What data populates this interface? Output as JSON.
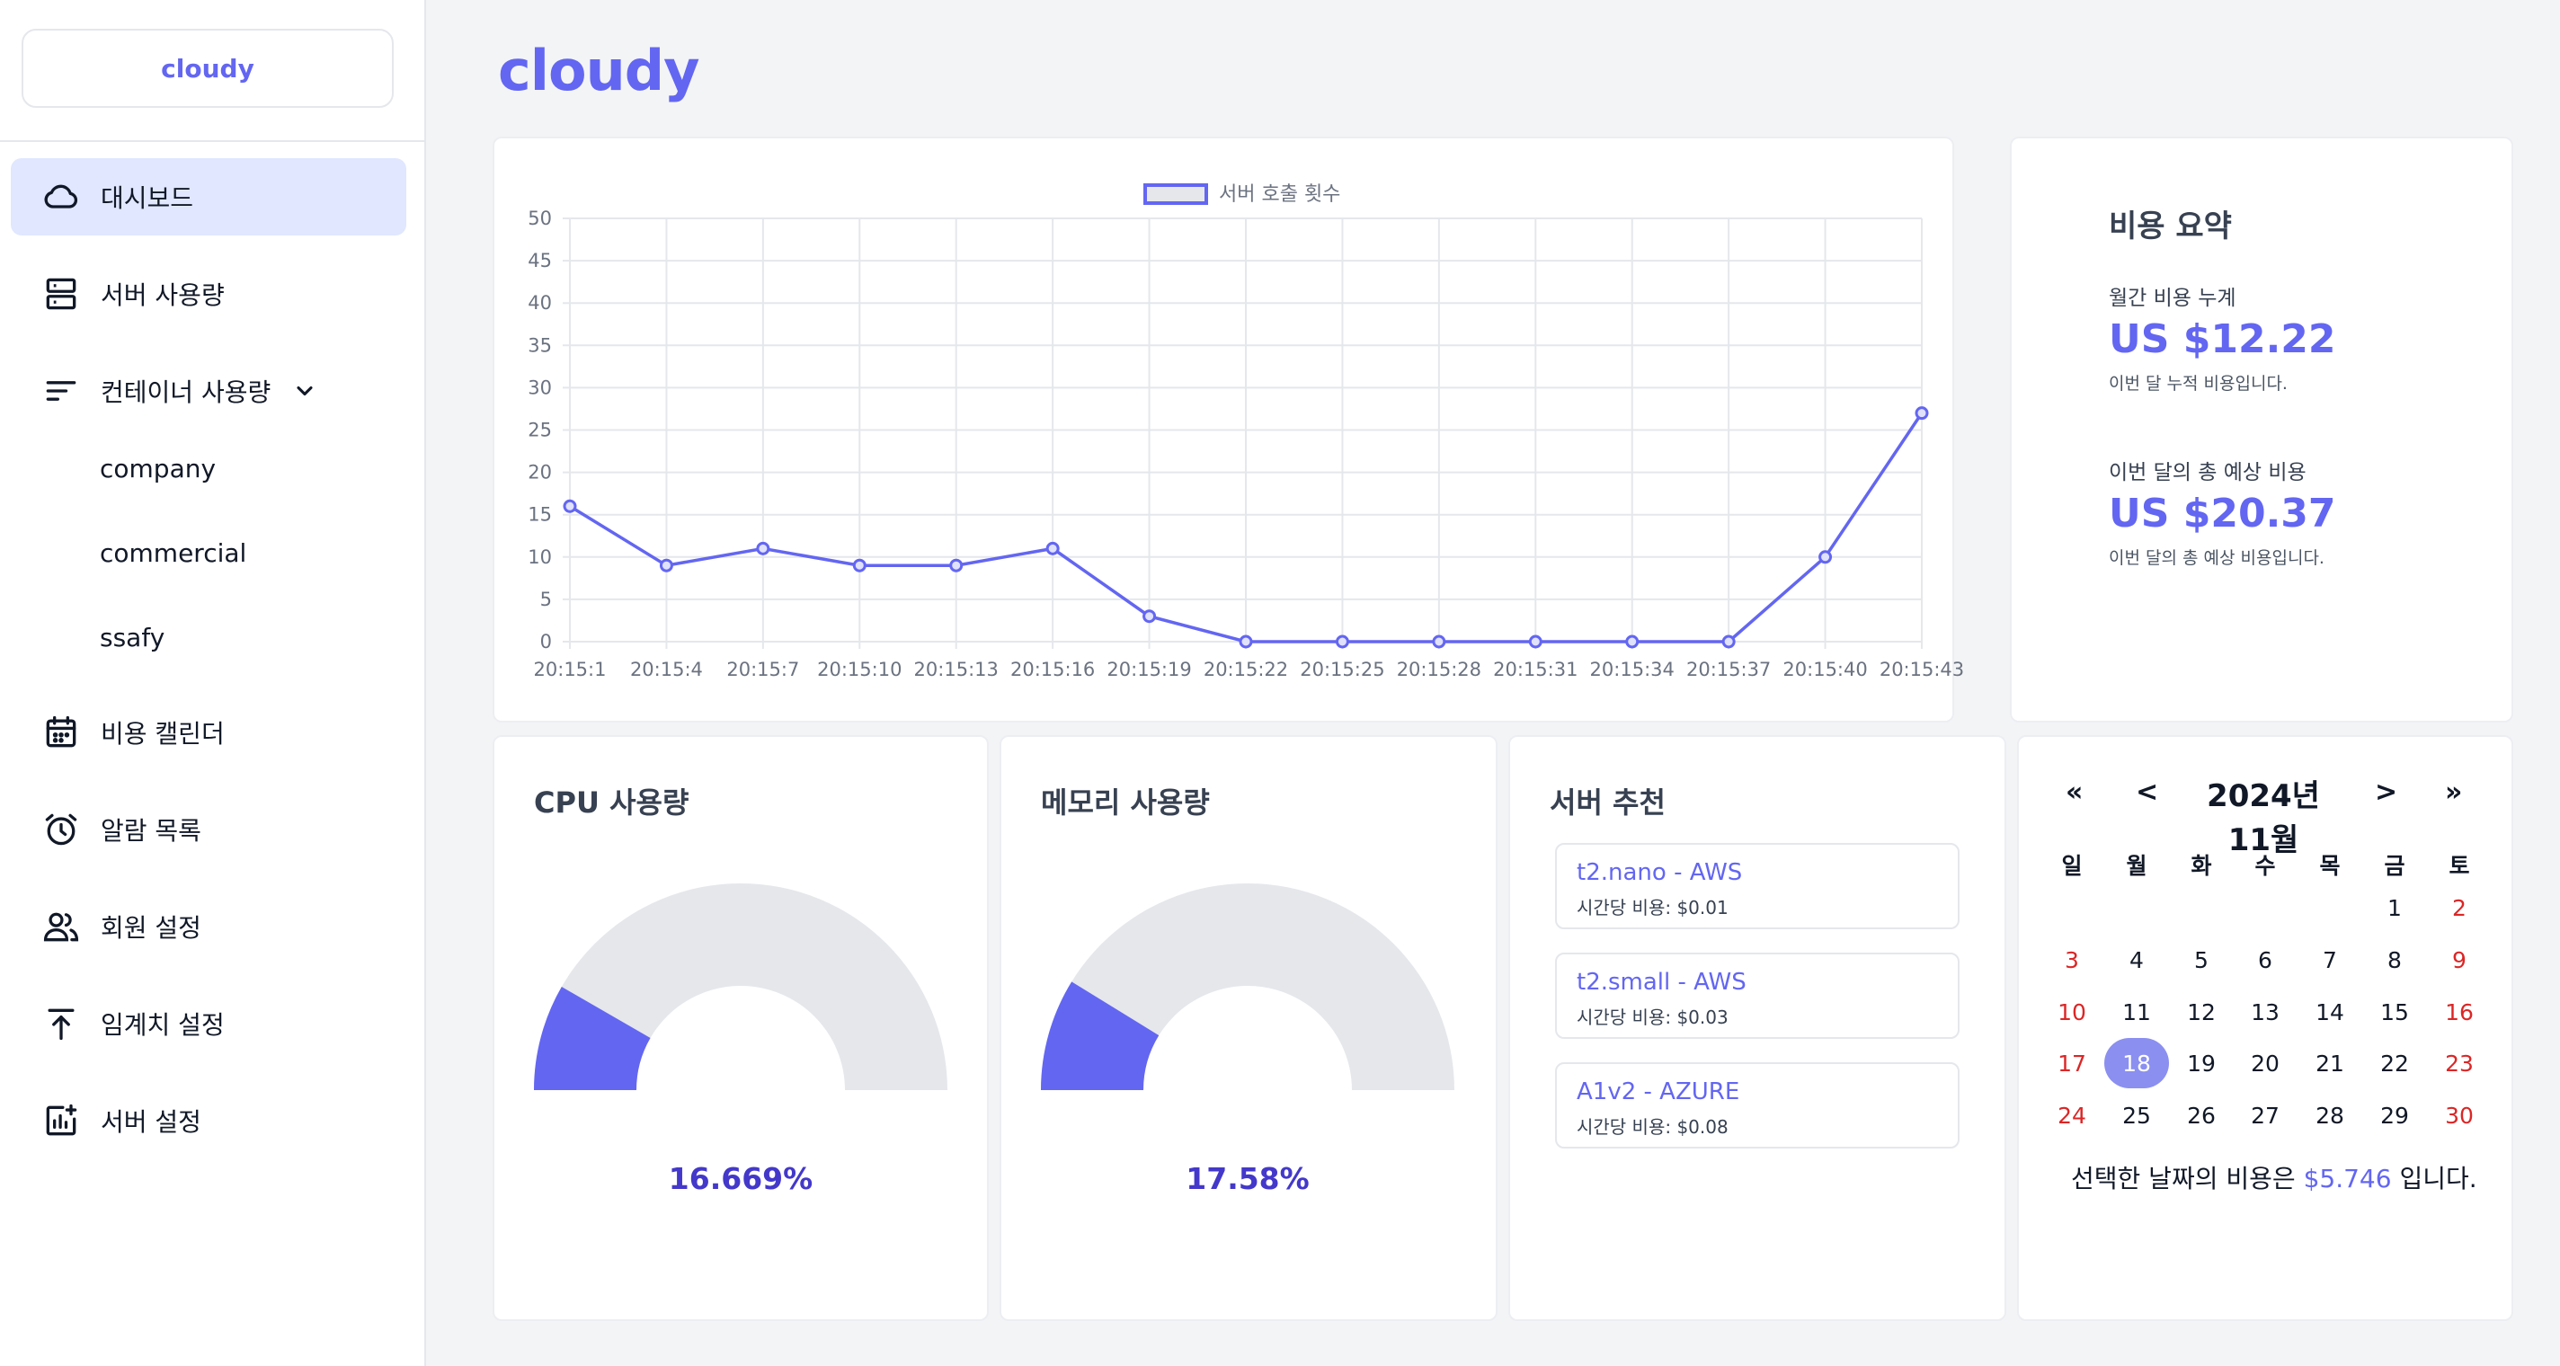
{
  "app": {
    "logo": "cloudy",
    "page_title": "cloudy"
  },
  "sidebar": {
    "items": [
      {
        "label": "대시보드",
        "icon": "cloud-icon",
        "active": true
      },
      {
        "label": "서버 사용량",
        "icon": "server-icon"
      },
      {
        "label": "컨테이너 사용량",
        "icon": "bars-icon",
        "expanded": true
      },
      {
        "label": "비용 캘린더",
        "icon": "calendar-icon"
      },
      {
        "label": "알람 목록",
        "icon": "alarm-clock-icon"
      },
      {
        "label": "회원 설정",
        "icon": "users-icon"
      },
      {
        "label": "임계치 설정",
        "icon": "arrow-up-icon"
      },
      {
        "label": "서버 설정",
        "icon": "chart-plus-icon"
      }
    ],
    "sub_items": [
      "company",
      "commercial",
      "ssafy"
    ]
  },
  "chart_data": {
    "type": "line",
    "legend": "서버 호출 횟수",
    "x": [
      "20:15:1",
      "20:15:4",
      "20:15:7",
      "20:15:10",
      "20:15:13",
      "20:15:16",
      "20:15:19",
      "20:15:22",
      "20:15:25",
      "20:15:28",
      "20:15:31",
      "20:15:34",
      "20:15:37",
      "20:15:40",
      "20:15:43"
    ],
    "series": [
      {
        "name": "서버 호출 횟수",
        "values": [
          16,
          9,
          11,
          9,
          9,
          11,
          3,
          0,
          0,
          0,
          0,
          0,
          0,
          10,
          27
        ]
      }
    ],
    "ylim": [
      0,
      50
    ],
    "yticks": [
      0,
      5,
      10,
      15,
      20,
      25,
      30,
      35,
      40,
      45,
      50
    ],
    "grid": true,
    "legend_position": "top",
    "color": "#6366f1"
  },
  "cost_summary": {
    "title": "비용 요약",
    "monthly_label": "월간 비용 누계",
    "monthly_value": "US $12.22",
    "monthly_note": "이번 달 누적 비용입니다.",
    "forecast_label": "이번 달의 총 예상 비용",
    "forecast_value": "US $20.37",
    "forecast_note": "이번 달의 총 예상 비용입니다."
  },
  "cpu": {
    "title": "CPU 사용량",
    "value_text": "16.669%",
    "percent": 16.669
  },
  "memory": {
    "title": "메모리 사용량",
    "value_text": "17.58%",
    "percent": 17.58
  },
  "recommendations": {
    "title": "서버 추천",
    "items": [
      {
        "name": "t2.nano - AWS",
        "price": "시간당 비용: $0.01"
      },
      {
        "name": "t2.small - AWS",
        "price": "시간당 비용: $0.03"
      },
      {
        "name": "A1v2 - AZURE",
        "price": "시간당 비용: $0.08"
      }
    ]
  },
  "calendar": {
    "nav": {
      "prev_year": "«",
      "prev_month": "<",
      "next_month": ">",
      "next_year": "»"
    },
    "title": "2024년 11월",
    "weekdays": [
      "일",
      "월",
      "화",
      "수",
      "목",
      "금",
      "토"
    ],
    "first_weekday": 5,
    "days": 30,
    "selected": 18,
    "footer_prefix": "선택한 날짜의 비용은",
    "footer_amount": "$5.746",
    "footer_suffix": "입니다.",
    "colors": {
      "weekend": "#dc2626",
      "selected": "#8b8ff0"
    }
  },
  "colors": {
    "accent": "#6366f1",
    "gauge_track": "#e5e7eb"
  }
}
